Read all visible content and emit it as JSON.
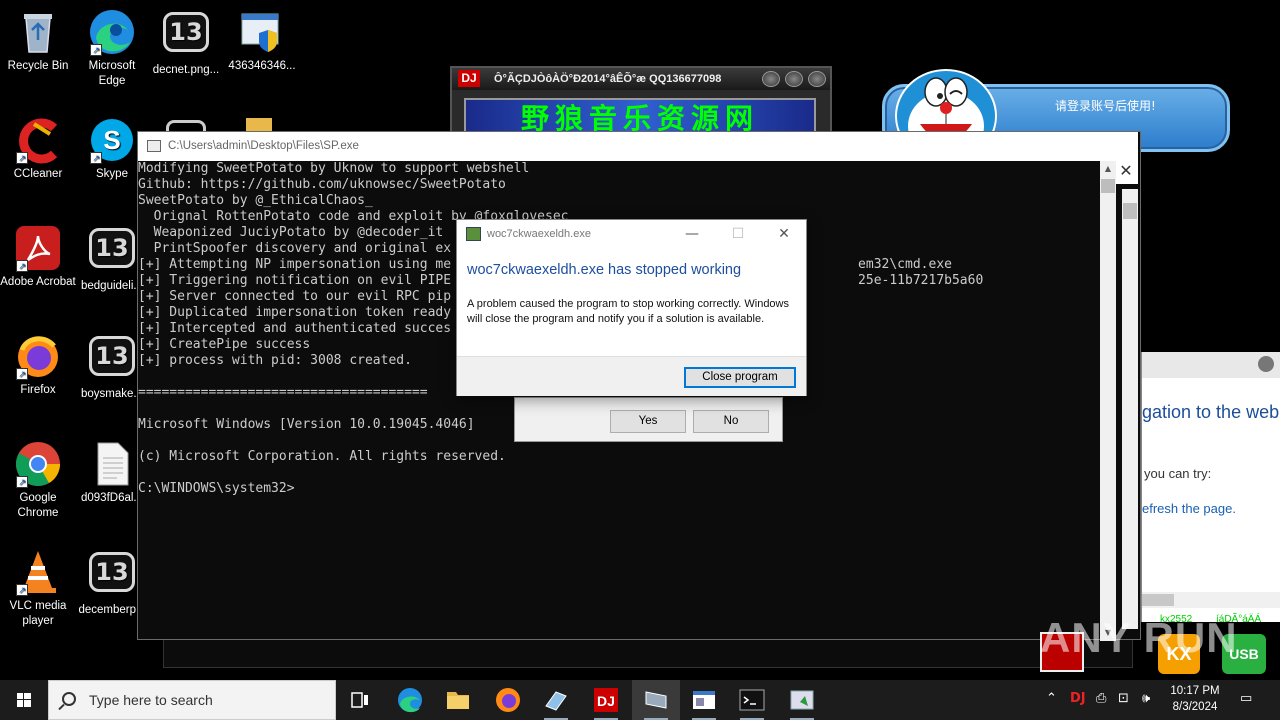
{
  "desktop": {
    "icons": [
      {
        "name": "recycle-bin",
        "label": "Recycle Bin"
      },
      {
        "name": "microsoft-edge",
        "label": "Microsoft Edge"
      },
      {
        "name": "decnet-file",
        "label": "decnet.png..."
      },
      {
        "name": "file-436",
        "label": "436346346..."
      },
      {
        "name": "ccleaner",
        "label": "CCleaner"
      },
      {
        "name": "skype",
        "label": "Skype"
      },
      {
        "name": "adobe-acrobat",
        "label": "Adobe Acrobat"
      },
      {
        "name": "bedguide-file",
        "label": "bedguideli..."
      },
      {
        "name": "firefox",
        "label": "Firefox"
      },
      {
        "name": "boysmake-file",
        "label": "boysmake..."
      },
      {
        "name": "google-chrome",
        "label": "Google Chrome"
      },
      {
        "name": "d093-file",
        "label": "d093fD6al..."
      },
      {
        "name": "vlc",
        "label": "VLC media player"
      },
      {
        "name": "december-file",
        "label": "decemberp..."
      }
    ]
  },
  "dj_window": {
    "title": "Ô°ÃÇDJÒôÀÖ°Ð2014°âÊÕ°æ QQ136677098",
    "logo": "DJ",
    "banner": "野狼音乐资源网"
  },
  "notice": {
    "text": "请登录账号后使用!"
  },
  "cmd": {
    "title": "C:\\Users\\admin\\Desktop\\Files\\SP.exe",
    "lines": [
      "Modifying SweetPotato by Uknow to support webshell",
      "Github: https://github.com/uknowsec/SweetPotato",
      "SweetPotato by @_EthicalChaos_",
      "  Orignal RottenPotato code and exploit by @foxglovesec",
      "  Weaponized JuciyPotato by @decoder_it",
      "  PrintSpoofer discovery and original ex",
      "[+] Attempting NP impersonation using me                                                    em32\\cmd.exe",
      "[+] Triggering notification on evil PIPE                                                    25e-11b7217b5a60",
      "[+] Server connected to our evil RPC pip",
      "[+] Duplicated impersonation token ready",
      "[+] Intercepted and authenticated succes",
      "[+] CreatePipe success",
      "[+] process with pid: 3008 created.",
      "",
      "=====================================",
      "",
      "Microsoft Windows [Version 10.0.19045.4046]",
      "",
      "(c) Microsoft Corporation. All rights reserved.",
      "",
      "C:\\WINDOWS\\system32>"
    ]
  },
  "error_dialog": {
    "title": "woc7ckwaexeldh.exe",
    "heading": "woc7ckwaexeldh.exe has stopped working",
    "message": "A problem caused the program to stop working correctly. Windows will close the program and notify you if a solution is available.",
    "close_button": "Close program"
  },
  "yes_no_dialog": {
    "yes": "Yes",
    "no": "No"
  },
  "edge_window": {
    "line1": "gation to the web",
    "line2": "you can try:",
    "line3": "efresh the page."
  },
  "tray_apps": {
    "label1": "kx2552",
    "label2": "íáDÃ°áÄÁ",
    "usb": "USB"
  },
  "watermark": "ANY RUN",
  "taskbar": {
    "search_placeholder": "Type here to search",
    "time": "10:17 PM",
    "date": "8/3/2024"
  },
  "colors": {
    "error_heading": "#1e4ea0",
    "console_text": "#cccccc",
    "notice_bg": "#2b7ccc",
    "taskbar_bg": "#1c1c1c"
  }
}
